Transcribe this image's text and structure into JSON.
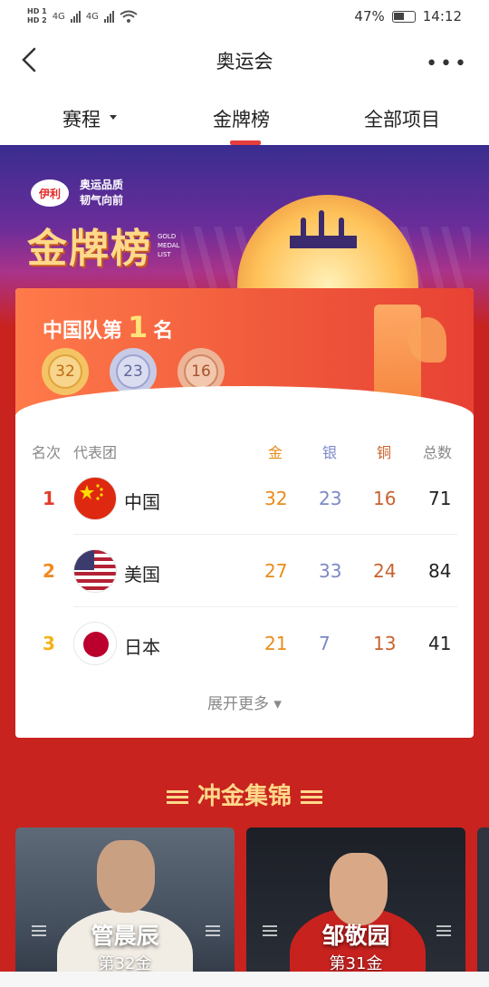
{
  "status_bar": {
    "network_left": "HD 1",
    "network_left2": "HD 2",
    "signal1": "4G",
    "signal2": "4G",
    "battery": "47%",
    "time": "14:12"
  },
  "navbar": {
    "title": "奥运会",
    "more": "•••"
  },
  "tabs": [
    {
      "label": "赛程"
    },
    {
      "label": "金牌榜"
    },
    {
      "label": "全部项目"
    }
  ],
  "banner": {
    "brand": "伊利",
    "slogan_1": "奥运品质",
    "slogan_2": "韧气向前",
    "title": "金牌榜",
    "title_en": "GOLD MEDAL LIST"
  },
  "summary": {
    "prefix": "中国队第",
    "rank": "1",
    "suffix": "名",
    "gold": "32",
    "silver": "23",
    "bronze": "16"
  },
  "table": {
    "headers": {
      "rank": "名次",
      "team": "代表团",
      "gold": "金",
      "silver": "银",
      "bronze": "铜",
      "total": "总数"
    },
    "rows": [
      {
        "rank": "1",
        "team": "中国",
        "gold": "32",
        "silver": "23",
        "bronze": "16",
        "total": "71",
        "rank_color": "#e23c2e"
      },
      {
        "rank": "2",
        "team": "美国",
        "gold": "27",
        "silver": "33",
        "bronze": "24",
        "total": "84",
        "rank_color": "#f08a24"
      },
      {
        "rank": "3",
        "team": "日本",
        "gold": "21",
        "silver": "7",
        "bronze": "13",
        "total": "41",
        "rank_color": "#f2b31d"
      }
    ],
    "expand_label": "展开更多 ▾"
  },
  "highlights": {
    "title": "冲金集锦",
    "cards": [
      {
        "name": "管晨辰",
        "sub": "第32金"
      },
      {
        "name": "邹敬园",
        "sub": "第31金"
      }
    ]
  },
  "colors": {
    "accent": "#e63d3d",
    "gold": "#e88c1a",
    "silver": "#7c88c8",
    "bronze": "#c8622e",
    "page_bg": "#c8231f"
  }
}
